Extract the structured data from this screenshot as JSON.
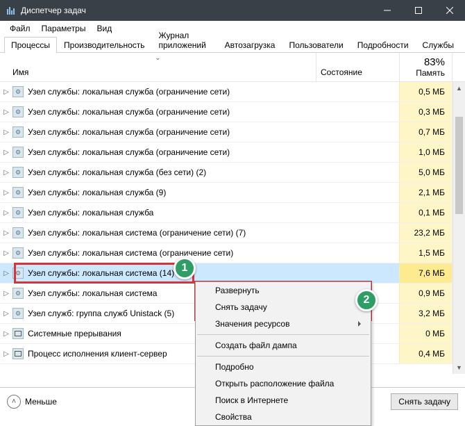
{
  "window": {
    "title": "Диспетчер задач"
  },
  "menu": {
    "file": "Файл",
    "options": "Параметры",
    "view": "Вид"
  },
  "tabs": {
    "processes": "Процессы",
    "performance": "Производительность",
    "apphistory": "Журнал приложений",
    "startup": "Автозагрузка",
    "users": "Пользователи",
    "details": "Подробности",
    "services": "Службы"
  },
  "headers": {
    "name": "Имя",
    "state": "Состояние",
    "memory_label": "Память",
    "memory_pct": "83%"
  },
  "rows": [
    {
      "name": "Узел службы: локальная служба (ограничение сети)",
      "mem": "0,5 МБ",
      "sel": false,
      "icon": "gear"
    },
    {
      "name": "Узел службы: локальная служба (ограничение сети)",
      "mem": "0,3 МБ",
      "sel": false,
      "icon": "gear"
    },
    {
      "name": "Узел службы: локальная служба (ограничение сети)",
      "mem": "0,7 МБ",
      "sel": false,
      "icon": "gear"
    },
    {
      "name": "Узел службы: локальная служба (ограничение сети)",
      "mem": "1,0 МБ",
      "sel": false,
      "icon": "gear"
    },
    {
      "name": "Узел службы: локальная служба (без сети) (2)",
      "mem": "5,0 МБ",
      "sel": false,
      "icon": "gear"
    },
    {
      "name": "Узел службы: локальная служба (9)",
      "mem": "2,1 МБ",
      "sel": false,
      "icon": "gear"
    },
    {
      "name": "Узел службы: локальная служба",
      "mem": "0,1 МБ",
      "sel": false,
      "icon": "gear"
    },
    {
      "name": "Узел службы: локальная система (ограничение сети) (7)",
      "mem": "23,2 МБ",
      "sel": false,
      "icon": "gear"
    },
    {
      "name": "Узел службы: локальная система (ограничение сети)",
      "mem": "1,5 МБ",
      "sel": false,
      "icon": "gear"
    },
    {
      "name": "Узел службы: локальная система (14)",
      "mem": "7,6 МБ",
      "sel": true,
      "icon": "gear"
    },
    {
      "name": "Узел службы: локальная система",
      "mem": "0,9 МБ",
      "sel": false,
      "icon": "gear"
    },
    {
      "name": "Узел служб: группа служб Unistack (5)",
      "mem": "3,2 МБ",
      "sel": false,
      "icon": "gear"
    },
    {
      "name": "Системные прерывания",
      "mem": "0 МБ",
      "sel": false,
      "icon": "sys"
    },
    {
      "name": "Процесс исполнения клиент-сервер",
      "mem": "0,4 МБ",
      "sel": false,
      "icon": "sys"
    }
  ],
  "context_menu": {
    "expand": "Развернуть",
    "end_task": "Снять задачу",
    "resource_values": "Значения ресурсов",
    "create_dump": "Создать файл дампа",
    "details": "Подробно",
    "open_location": "Открыть расположение файла",
    "search_online": "Поиск в Интернете",
    "properties": "Свойства"
  },
  "bottom": {
    "less": "Меньше",
    "end_task": "Снять задачу"
  },
  "badges": {
    "one": "1",
    "two": "2"
  }
}
